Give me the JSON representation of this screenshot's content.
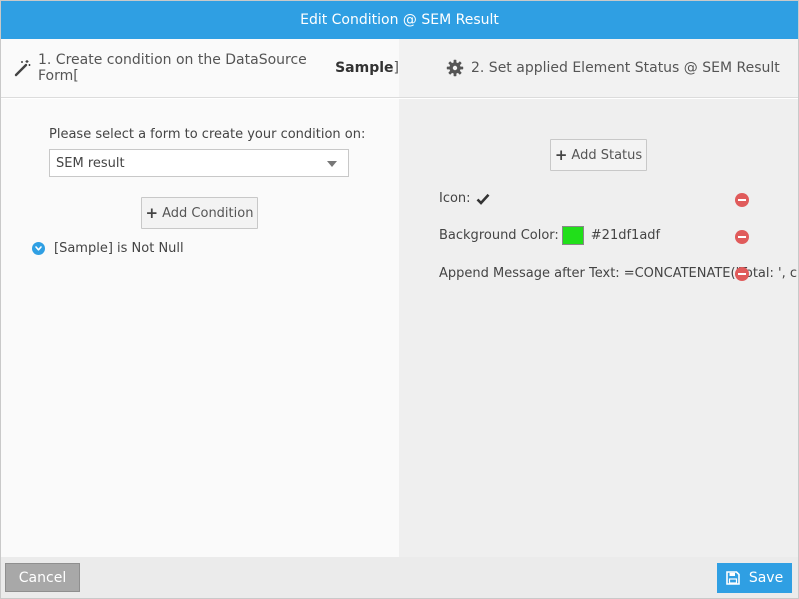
{
  "dialog": {
    "title": "Edit Condition @ SEM Result"
  },
  "left": {
    "header_prefix": "1. Create condition on the DataSource Form[",
    "header_bold": "Sample",
    "header_suffix": "]",
    "select_label": "Please select a form to create your condition on:",
    "select_value": "SEM result",
    "add_condition_label": "Add Condition",
    "conditions": [
      {
        "text": "[Sample] is Not Null"
      }
    ]
  },
  "right": {
    "header": "2. Set applied Element Status @ SEM Result",
    "add_status_label": "Add Status",
    "statuses": [
      {
        "label": "Icon:",
        "icon": "check-icon"
      },
      {
        "label": "Background Color:",
        "color": "#21df1a",
        "value": "#21df1adf"
      },
      {
        "label": "Append Message after Text:",
        "value": "=CONCATENATE('Total: ', c"
      }
    ]
  },
  "footer": {
    "cancel_label": "Cancel",
    "save_label": "Save"
  },
  "colors": {
    "accent": "#2f9fe3",
    "remove": "#e05b5b",
    "cancel": "#a8a8a8"
  }
}
